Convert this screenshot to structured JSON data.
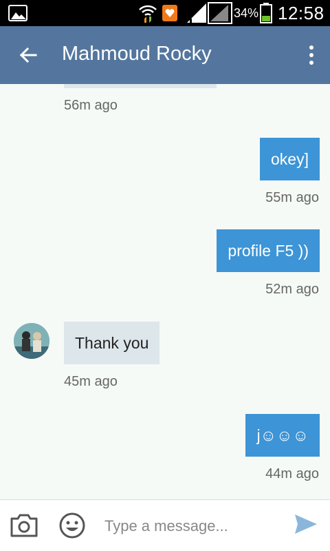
{
  "status_bar": {
    "battery_percent": "34%",
    "time": "12:58",
    "icons": [
      "gallery-icon",
      "wifi-icon",
      "notification-icon",
      "signal-icon",
      "signal-icon",
      "battery-icon"
    ]
  },
  "header": {
    "title": "Mahmoud Rocky",
    "back_icon": "back-arrow-icon",
    "menu_icon": "overflow-menu-icon"
  },
  "messages": [
    {
      "direction": "incoming",
      "text": "",
      "time": "56m ago"
    },
    {
      "direction": "outgoing",
      "text": "okey]",
      "time": "55m ago"
    },
    {
      "direction": "outgoing",
      "text": "profile F5 ))",
      "time": "52m ago"
    },
    {
      "direction": "incoming",
      "text": "Thank you",
      "time": "45m ago",
      "avatar": "contact-avatar"
    },
    {
      "direction": "outgoing",
      "text": "j☺☺☺",
      "time": "44m ago"
    }
  ],
  "composer": {
    "placeholder": "Type a message...",
    "camera_icon": "camera-icon",
    "emoji_icon": "emoji-icon",
    "send_icon": "send-icon"
  },
  "colors": {
    "app_bar": "#54769e",
    "outgoing_bubble": "#3d94d6",
    "incoming_bubble": "#dde6ea",
    "background": "#f5faf7"
  }
}
